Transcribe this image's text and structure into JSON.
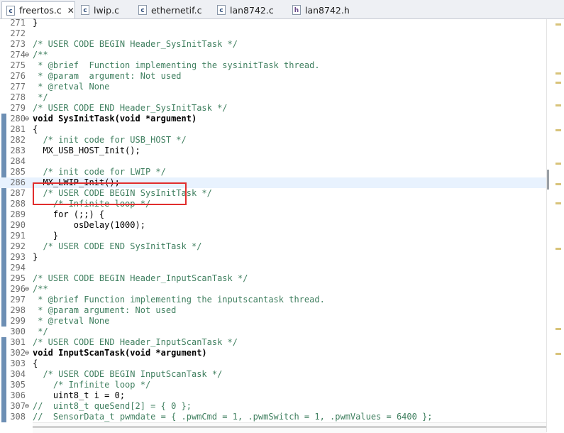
{
  "tabs": [
    {
      "name": "freertos.c",
      "icon": "c-source-file-icon",
      "active": true
    },
    {
      "name": "lwip.c",
      "icon": "c-source-file-icon",
      "active": false
    },
    {
      "name": "ethernetif.c",
      "icon": "c-source-file-icon",
      "active": false
    },
    {
      "name": "lan8742.c",
      "icon": "c-source-file-icon",
      "active": false
    },
    {
      "name": "lan8742.h",
      "icon": "header-file-icon",
      "active": false
    }
  ],
  "tab_close_symbol": "✕",
  "icon_glyphs": {
    "c": "c",
    "h": "h"
  },
  "lines": [
    {
      "n": "271",
      "t": "}"
    },
    {
      "n": "272",
      "t": ""
    },
    {
      "n": "273",
      "t": "/* USER CODE BEGIN Header_SysInitTask */"
    },
    {
      "n": "274",
      "t": "/**"
    },
    {
      "n": "275",
      "t": " * @brief  Function implementing the sysinitTask thread."
    },
    {
      "n": "276",
      "t": " * @param  argument: Not used"
    },
    {
      "n": "277",
      "t": " * @retval None"
    },
    {
      "n": "278",
      "t": " */"
    },
    {
      "n": "279",
      "t": "/* USER CODE END Header_SysInitTask */"
    },
    {
      "n": "280",
      "t": "void SysInitTask(void *argument)"
    },
    {
      "n": "281",
      "t": "{"
    },
    {
      "n": "282",
      "t": "  /* init code for USB_HOST */"
    },
    {
      "n": "283",
      "t": "  MX_USB_HOST_Init();"
    },
    {
      "n": "284",
      "t": ""
    },
    {
      "n": "285",
      "t": "  /* init code for LWIP */"
    },
    {
      "n": "286",
      "t": "  MX_LWIP_Init();"
    },
    {
      "n": "287",
      "t": "  /* USER CODE BEGIN SysInitTask */"
    },
    {
      "n": "288",
      "t": "    /* Infinite loop */"
    },
    {
      "n": "289",
      "t": "    for (;;) {"
    },
    {
      "n": "290",
      "t": "        osDelay(1000);"
    },
    {
      "n": "291",
      "t": "    }"
    },
    {
      "n": "292",
      "t": "  /* USER CODE END SysInitTask */"
    },
    {
      "n": "293",
      "t": "}"
    },
    {
      "n": "294",
      "t": ""
    },
    {
      "n": "295",
      "t": "/* USER CODE BEGIN Header_InputScanTask */"
    },
    {
      "n": "296",
      "t": "/**"
    },
    {
      "n": "297",
      "t": " * @brief Function implementing the inputscantask thread."
    },
    {
      "n": "298",
      "t": " * @param argument: Not used"
    },
    {
      "n": "299",
      "t": " * @retval None"
    },
    {
      "n": "300",
      "t": " */"
    },
    {
      "n": "301",
      "t": "/* USER CODE END Header_InputScanTask */"
    },
    {
      "n": "302",
      "t": "void InputScanTask(void *argument)"
    },
    {
      "n": "303",
      "t": "{"
    },
    {
      "n": "304",
      "t": "  /* USER CODE BEGIN InputScanTask */"
    },
    {
      "n": "305",
      "t": "    /* Infinite loop */"
    },
    {
      "n": "306",
      "t": "    uint8_t i = 0;"
    },
    {
      "n": "307",
      "t": "//  uint8_t queSend[2] = { 0 };"
    },
    {
      "n": "308",
      "t": "//  SensorData_t pwmdate = { .pwmCmd = 1, .pwmSwitch = 1, .pwmValues = 6400 };"
    }
  ],
  "fold_symbol": "⊖",
  "fold_lines": [
    "274",
    "280",
    "296",
    "302",
    "307"
  ],
  "highlighted_line": "286",
  "colors": {
    "comment": "#3f7f5f",
    "keyword": "#7f0055",
    "annotation_box": "#e12d2d",
    "line_highlight": "#e8f2fe"
  }
}
